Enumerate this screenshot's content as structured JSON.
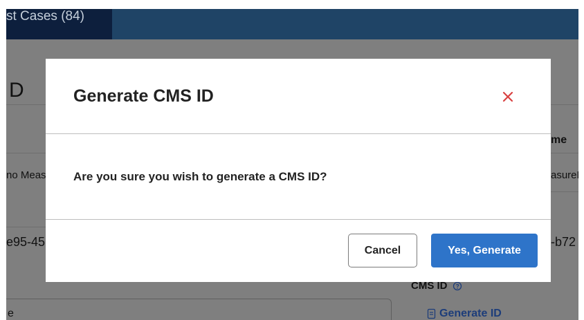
{
  "background": {
    "active_tab_label": "st Cases (84)",
    "section_title_fragment": "D",
    "column_header_fragment": "me",
    "row1_left_fragment": "no Meas",
    "row1_right_fragment": "asureN",
    "row2_left_fragment": "e95-45",
    "row2_right_fragment": "-b72",
    "cms_id_label": "CMS ID",
    "generate_id_link": "Generate ID",
    "bottom_left_fragment": "e"
  },
  "modal": {
    "title": "Generate CMS ID",
    "message": "Are you sure you wish to generate a CMS ID?",
    "cancel_label": "Cancel",
    "confirm_label": "Yes, Generate"
  },
  "colors": {
    "header_bar": "#1f4466",
    "active_tab": "#0d1f3d",
    "overlay_gray": "#7f7f7f",
    "close_red": "#d94141",
    "primary_button": "#2e74c9"
  },
  "icons": [
    "close-icon",
    "help-circle-icon",
    "document-icon"
  ]
}
